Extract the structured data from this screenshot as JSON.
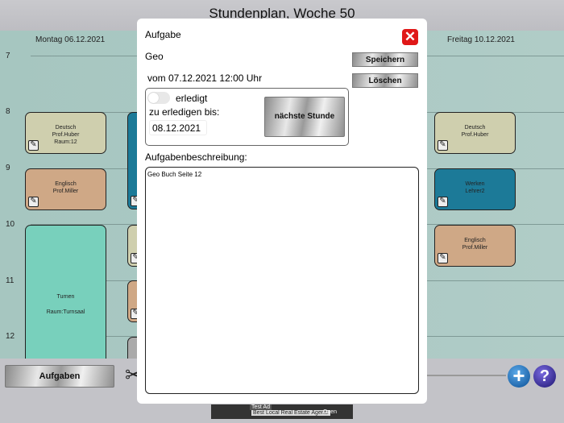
{
  "header": {
    "title": "Stundenplan, Woche 50"
  },
  "days": [
    "Montag 06.12.2021",
    "Freitag 10.12.2021"
  ],
  "hours": [
    "7",
    "8",
    "9",
    "10",
    "11",
    "12"
  ],
  "cards": {
    "mon_deutsch": {
      "subject": "Deutsch",
      "teacher": "Prof.Huber",
      "room": "Raum:12"
    },
    "mon_englisch": {
      "subject": "Englisch",
      "teacher": "Prof.Miller"
    },
    "mon_turnen": {
      "subject": "Turnen",
      "room": "Raum:Turnsaal"
    },
    "fri_deutsch": {
      "subject": "Deutsch",
      "teacher": "Prof.Huber"
    },
    "fri_werken": {
      "subject": "Werken",
      "teacher": "Lehrer2"
    },
    "fri_englisch": {
      "subject": "Englisch",
      "teacher": "Prof.Miller"
    }
  },
  "bottom": {
    "aufgaben_label": "Aufgaben"
  },
  "ad": {
    "badge": "Test Ad",
    "text": "Best Local Real Estate Agents",
    "open": "Open"
  },
  "modal": {
    "title": "Aufgabe",
    "subject": "Geo",
    "from": "vom 07.12.2021 12:00 Uhr",
    "done_label": "erledigt",
    "done": false,
    "due_label": "zu erledigen bis:",
    "due_date": "08.12.2021",
    "next_lesson": "nächste Stunde",
    "save": "Speichern",
    "delete": "Löschen",
    "desc_label": "Aufgabenbeschreibung:",
    "description": "Geo Buch Seite 12"
  },
  "colors": {
    "yellow": "#cfcfae",
    "brown": "#cfa886",
    "teal": "#1c7a98",
    "mint": "#78d0bc"
  }
}
